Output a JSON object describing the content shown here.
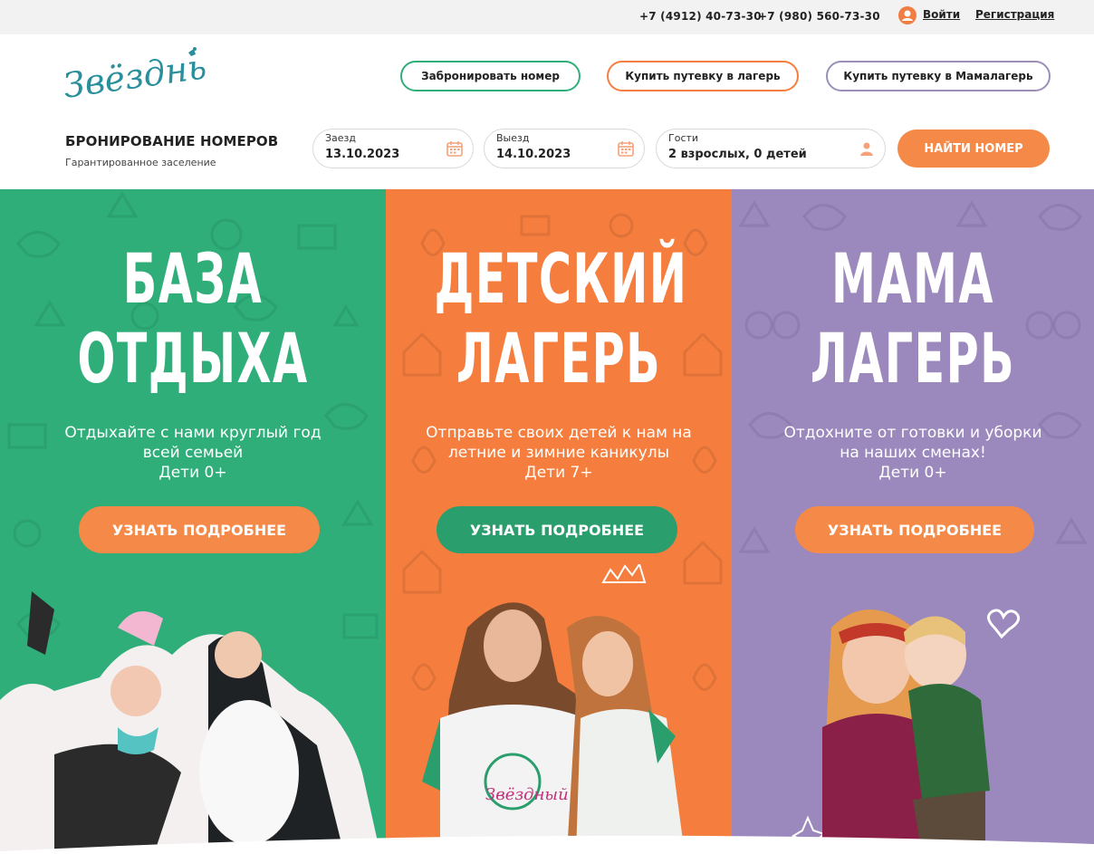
{
  "topbar": {
    "phone1": "+7 (4912) 40-73-30",
    "phone2": "+7 (980) 560-73-30",
    "login": "Войти",
    "register": "Регистрация"
  },
  "header": {
    "logo_text": "Звёздный",
    "btn_book": "Забронировать номер",
    "btn_camp": "Купить путевку в лагерь",
    "btn_mama": "Купить путевку в Мамалагерь"
  },
  "booking": {
    "title": "БРОНИРОВАНИЕ НОМЕРОВ",
    "subtitle": "Гарантированное заселение",
    "checkin_label": "Заезд",
    "checkin_value": "13.10.2023",
    "checkout_label": "Выезд",
    "checkout_value": "14.10.2023",
    "guests_label": "Гости",
    "guests_value": "2 взрослых, 0 детей",
    "find_button": "НАЙТИ НОМЕР"
  },
  "panels": [
    {
      "title_line1": "БАЗА",
      "title_line2": "ОТДЫХА",
      "desc_line1": "Отдыхайте с нами круглый год",
      "desc_line2": "всей семьей",
      "desc_line3": "Дети 0+",
      "button": "УЗНАТЬ ПОДРОБНЕЕ"
    },
    {
      "title_line1": "ДЕТСКИЙ",
      "title_line2": "ЛАГЕРЬ",
      "desc_line1": "Отправьте своих детей к нам на",
      "desc_line2": "летние и зимние каникулы",
      "desc_line3": "Дети 7+",
      "button": "УЗНАТЬ ПОДРОБНЕЕ"
    },
    {
      "title_line1": "МАМА",
      "title_line2": "ЛАГЕРЬ",
      "desc_line1": "Отдохните от готовки и уборки",
      "desc_line2": "на наших сменах!",
      "desc_line3": "Дети 0+",
      "button": "УЗНАТЬ ПОДРОБНЕЕ"
    }
  ],
  "colors": {
    "green": "#2fae7a",
    "orange": "#f57e3e",
    "purple": "#9b88bd",
    "button_orange": "#f58947",
    "button_green": "#2b9e6d",
    "teal_logo": "#2a8f9c",
    "mama_border": "#9b8fb8"
  },
  "icons": {
    "user": "user-icon",
    "calendar": "calendar-icon",
    "guest": "person-icon"
  }
}
